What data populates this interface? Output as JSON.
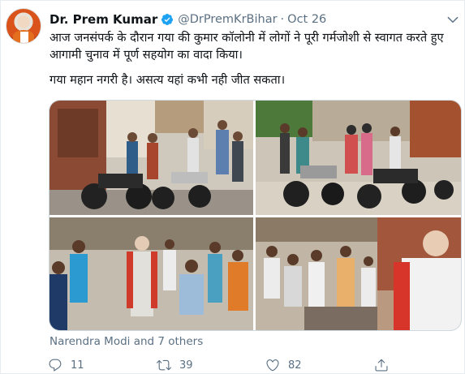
{
  "tweet": {
    "author_name": "Dr. Prem Kumar",
    "handle": "@DrPremKrBihar",
    "separator": "·",
    "date": "Oct 26",
    "text_line1": "आज जनसंपर्क के दौरान गया की कुमार कॉलोनी में लोगों ने पूरी गर्मजोशी से स्वागत करते हुए आगामी चुनाव में पूर्ण सहयोग का वादा किया।",
    "text_line2": "गया महान नगरी है। असत्य यहां कभी नही जीत सकता।",
    "liked_by": "Narendra Modi and 7 others",
    "reply_count": "11",
    "retweet_count": "39",
    "like_count": "82"
  },
  "icons": {
    "verified": "verified-badge-icon",
    "caret": "chevron-down-icon",
    "reply": "reply-icon",
    "retweet": "retweet-icon",
    "like": "heart-icon",
    "share": "share-icon"
  },
  "colors": {
    "text": "#0f1419",
    "secondary": "#5b7083",
    "verified": "#1da1f2",
    "border": "#e6ecf0"
  }
}
